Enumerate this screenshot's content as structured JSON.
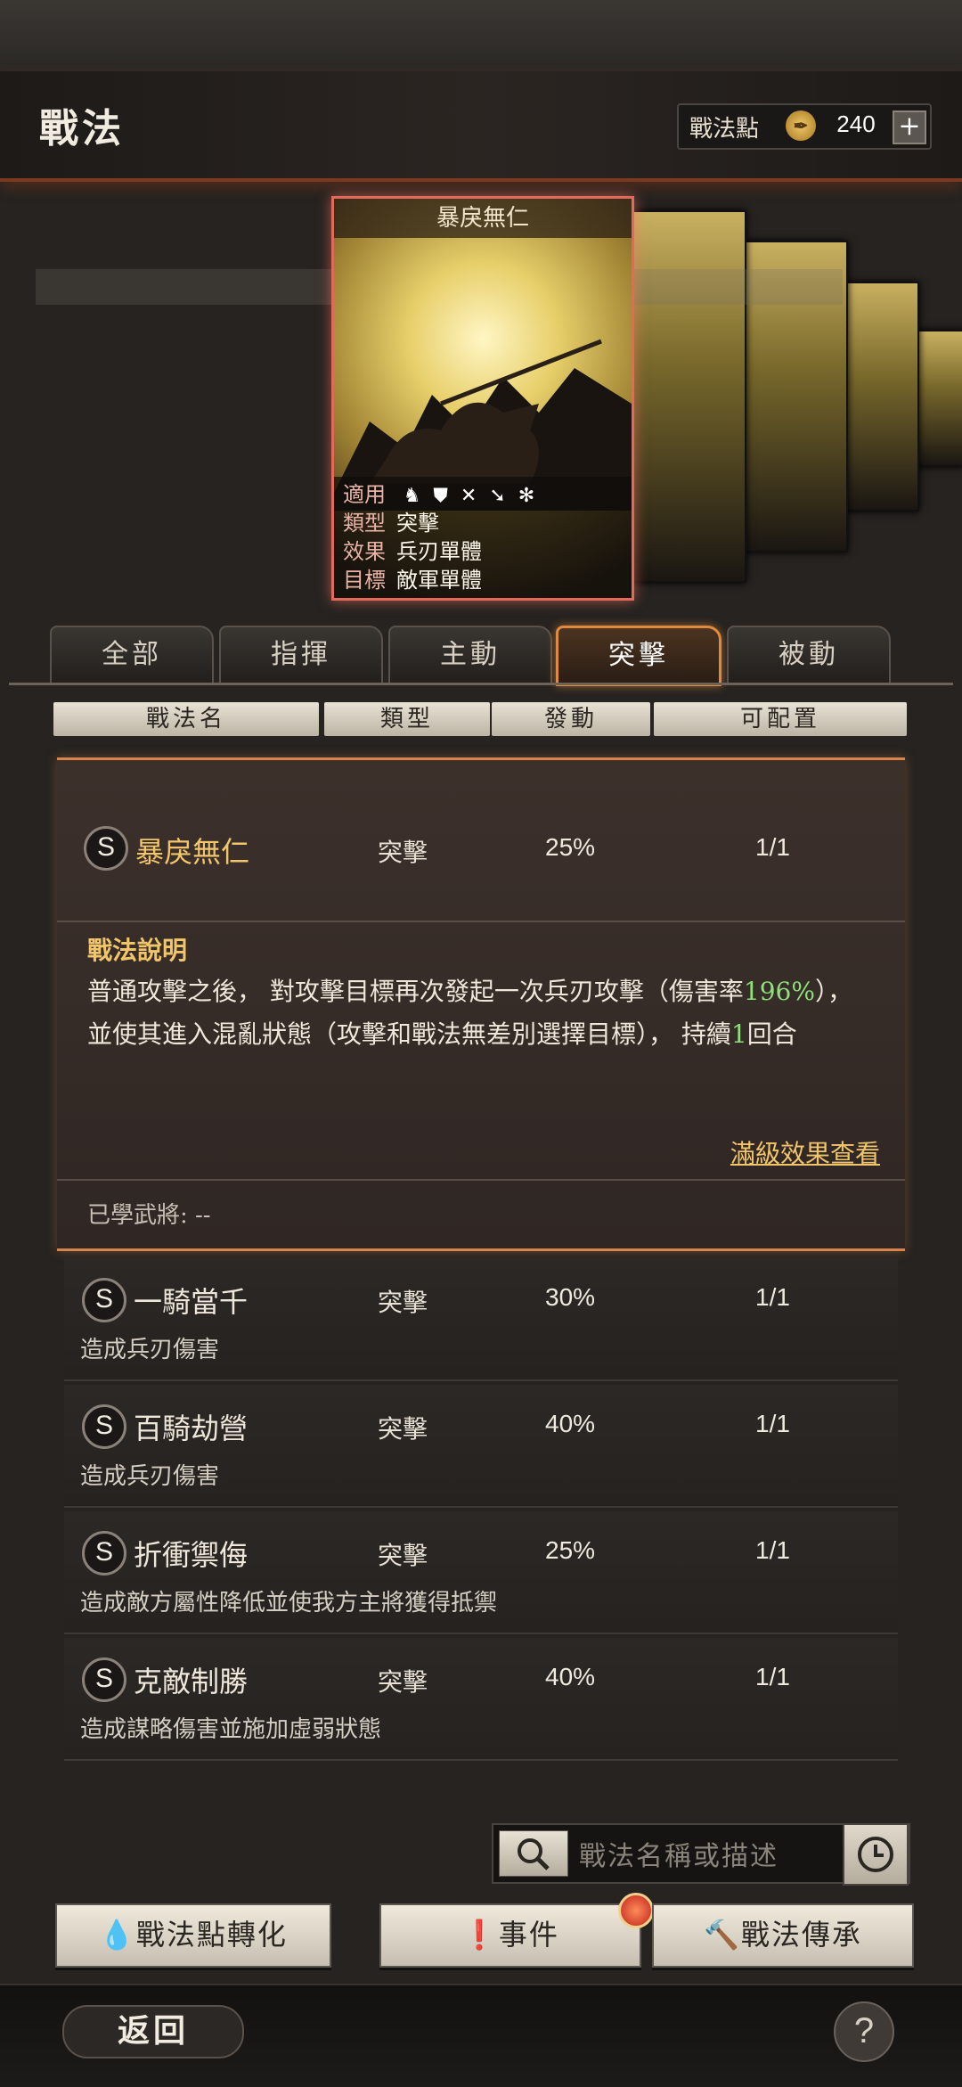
{
  "header": {
    "title": "戰法",
    "points_label": "戰法點",
    "points_value": "240",
    "add_label": "+"
  },
  "card": {
    "name": "暴戾無仁",
    "rows": [
      {
        "key": "適用",
        "value": ""
      },
      {
        "key": "類型",
        "value": "突擊"
      },
      {
        "key": "效果",
        "value": "兵刃單體"
      },
      {
        "key": "目標",
        "value": "敵軍單體"
      }
    ],
    "applicable_icons": [
      "cavalry-icon",
      "shield-icon",
      "bow-icon",
      "spear-icon",
      "siege-icon"
    ]
  },
  "tabs": [
    {
      "label": "全部",
      "active": false
    },
    {
      "label": "指揮",
      "active": false
    },
    {
      "label": "主動",
      "active": false
    },
    {
      "label": "突擊",
      "active": true
    },
    {
      "label": "被動",
      "active": false
    }
  ],
  "columns": [
    "戰法名",
    "類型",
    "發動",
    "可配置"
  ],
  "expanded": {
    "grade": "S",
    "name": "暴戾無仁",
    "type": "突擊",
    "rate": "25%",
    "slots": "1/1",
    "desc_title": "戰法說明",
    "desc_part1": "普通攻擊之後， 對攻擊目標再次發起一次兵刃攻擊（傷害率",
    "desc_pct": "196%",
    "desc_part2": "）， 並使其進入混亂狀態（攻擊和戰法無差別選擇目標）， 持續",
    "desc_turns": "1",
    "desc_part3": "回合",
    "full_view": "滿級效果查看",
    "learned": "已學武將: --"
  },
  "rows": [
    {
      "grade": "S",
      "name": "一騎當千",
      "type": "突擊",
      "rate": "30%",
      "slots": "1/1",
      "desc": "造成兵刃傷害"
    },
    {
      "grade": "S",
      "name": "百騎劫營",
      "type": "突擊",
      "rate": "40%",
      "slots": "1/1",
      "desc": "造成兵刃傷害"
    },
    {
      "grade": "S",
      "name": "折衝禦侮",
      "type": "突擊",
      "rate": "25%",
      "slots": "1/1",
      "desc": "造成敵方屬性降低並使我方主將獲得抵禦"
    },
    {
      "grade": "S",
      "name": "克敵制勝",
      "type": "突擊",
      "rate": "40%",
      "slots": "1/1",
      "desc": "造成謀略傷害並施加虛弱狀態"
    }
  ],
  "search": {
    "placeholder": "戰法名稱或描述"
  },
  "buttons": {
    "convert": "戰法點轉化",
    "event": "事件",
    "inherit": "戰法傳承"
  },
  "footer": {
    "back": "返回",
    "help": "?"
  },
  "colors": {
    "accent": "#e08a3e",
    "highlight_text": "#f1c56a",
    "green_value": "#8fe07a"
  }
}
